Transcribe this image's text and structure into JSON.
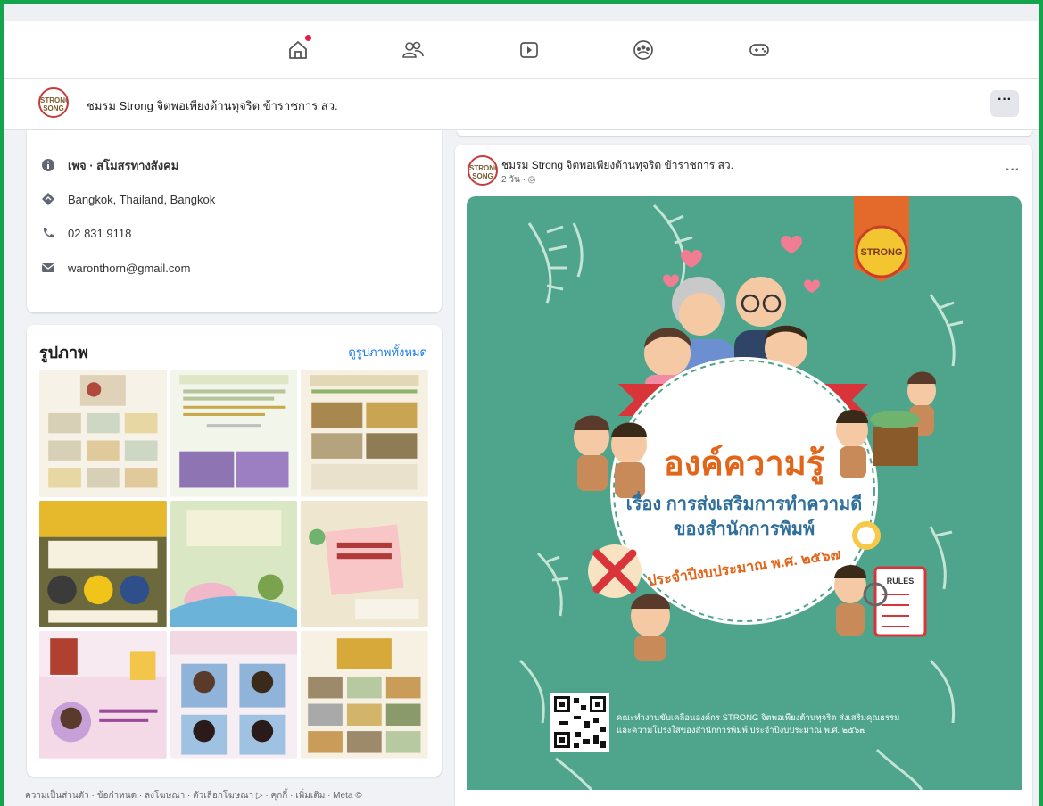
{
  "page": {
    "name": "ชมรม Strong จิตพอเพียงต้านทุจริต ข้าราชการ สว.",
    "more": "···"
  },
  "logo": {
    "line1": "STRONG",
    "line2": "SONG"
  },
  "nav": {
    "icons": [
      "home-icon",
      "friends-icon",
      "watch-icon",
      "groups-icon",
      "gaming-icon"
    ],
    "home_has_notification": true
  },
  "intro": {
    "category": "เพจ · สโมสรทางสังคม",
    "address": "Bangkok, Thailand, Bangkok",
    "phone": "02 831 9118",
    "email": "waronthorn@gmail.com"
  },
  "photos": {
    "title": "รูปภาพ",
    "see_all": "ดูรูปภาพทั้งหมด"
  },
  "footer": {
    "text": "ความเป็นส่วนตัว · ข้อกำหนด · ลงโฆษณา · ตัวเลือกโฆษณา ▷ · คุกกี้ · เพิ่มเติม · Meta ©"
  },
  "post": {
    "author": "ชมรม Strong จิตพอเพียงต้านทุจริต ข้าราชการ สว.",
    "meta": "2 วัน · ◎",
    "more": "···",
    "poster": {
      "title": "องค์ความรู้",
      "subtitle1": "เรื่อง การส่งเสริมการทำความดี",
      "subtitle2": "ของสำนักการพิมพ์",
      "arc": "ประจำปีงบประมาณ พ.ศ. ๒๕๖๗",
      "caption1": "คณะทำงานขับเคลื่อนองค์กร STRONG จิตพอเพียงต้านทุจริต ส่งเสริมคุณธรรม",
      "caption2": "และความโปร่งใสของสำนักการพิมพ์ ประจำปีงบประมาณ พ.ศ. ๒๕๖๗",
      "badge_text": "STRONG",
      "rules_text": "RULES"
    }
  },
  "colors": {
    "accent": "#1877f2",
    "frame": "#14a44d",
    "poster_bg": "#4fa58b",
    "title_orange": "#e2661a",
    "ribbon_red": "#d8343a"
  }
}
